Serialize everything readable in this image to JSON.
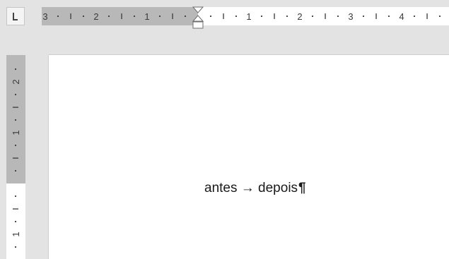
{
  "ruler": {
    "tab_type": "left-tab",
    "horizontal": {
      "origin_value": 0,
      "labels": [
        "3",
        "2",
        "1",
        "1",
        "2",
        "3",
        "4"
      ],
      "label_values": [
        -3,
        -2,
        -1,
        1,
        2,
        3,
        4
      ],
      "minor_value_range": [
        -3.75,
        4.75
      ],
      "visible_value_range": [
        -3.25,
        4.75
      ],
      "margin_value_range": [
        -3.25,
        0
      ]
    },
    "vertical": {
      "labels": [
        "2",
        "1",
        "1"
      ],
      "label_values": [
        -2,
        -1,
        1
      ],
      "visible_value_range": [
        -2.5,
        1.45
      ],
      "margin_value_range": [
        -2.5,
        0
      ]
    }
  },
  "document": {
    "word_before": "antes",
    "arrow": "→",
    "word_after": "depois",
    "paragraph_mark": "¶"
  },
  "colors": {
    "ruler_margin": "#b8b8b8",
    "ruler_text": "#3a3a3a",
    "workspace": "#e3e3e3",
    "page": "#ffffff"
  }
}
